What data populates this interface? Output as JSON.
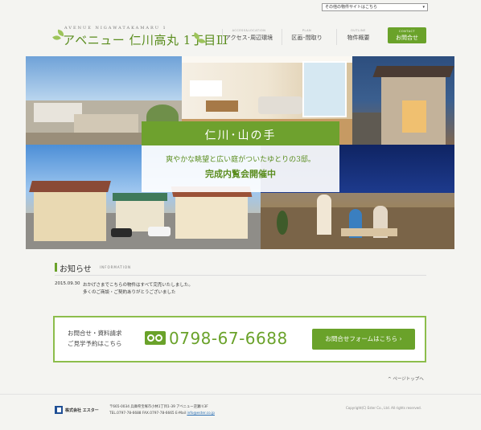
{
  "site_select": {
    "value": "その他の物件サイトはこちら"
  },
  "logo": {
    "en": "AVENUE NIGAWATAKAMARU 1",
    "jp": "アベニュー 仁川高丸 1丁目Ⅲ"
  },
  "nav": [
    {
      "sub": "ACCESS&LOCATION",
      "label": "アクセス･周辺環境"
    },
    {
      "sub": "PLAN",
      "label": "区画･間取り"
    },
    {
      "sub": "OUTLINE",
      "label": "物件概要"
    }
  ],
  "contact_nav": {
    "sub": "CONTACT",
    "label": "お問合せ"
  },
  "hero": {
    "title": "仁川･山の手",
    "line1": "爽やかな眺望と広い庭がついたゆとりの3邸。",
    "line2": "完成内覧会開催中"
  },
  "news": {
    "title": "お知らせ",
    "title_en": "INFORMATION",
    "date": "2015.09.30",
    "text1": "おかげさまでこちらの物件はすべて完売いたしました。",
    "text2": "多くのご商談・ご契約ありがとうございました"
  },
  "contact_box": {
    "line1": "お問合せ・資料請求",
    "line2": "ご見学予約はこちら",
    "phone": "0798-67-6688",
    "form_button": "お問合せフォームはこちら"
  },
  "pagetop": "ページトップへ",
  "footer": {
    "company": "株式会社 エスター",
    "address": "〒665-0034 兵庫県宝塚市小林1丁目1-39 アベニュー逆瀬川3F",
    "telfax": "TEL.0797-78-6688 FAX.0797-78-6665",
    "email_label": "E-Mail",
    "email": "info@ester.co.jp",
    "copyright": "Copyright(C) Ester Co., Ltd. All rights reserved."
  },
  "colors": {
    "accent": "#6aa22a",
    "brand_blue": "#1f4f95"
  }
}
